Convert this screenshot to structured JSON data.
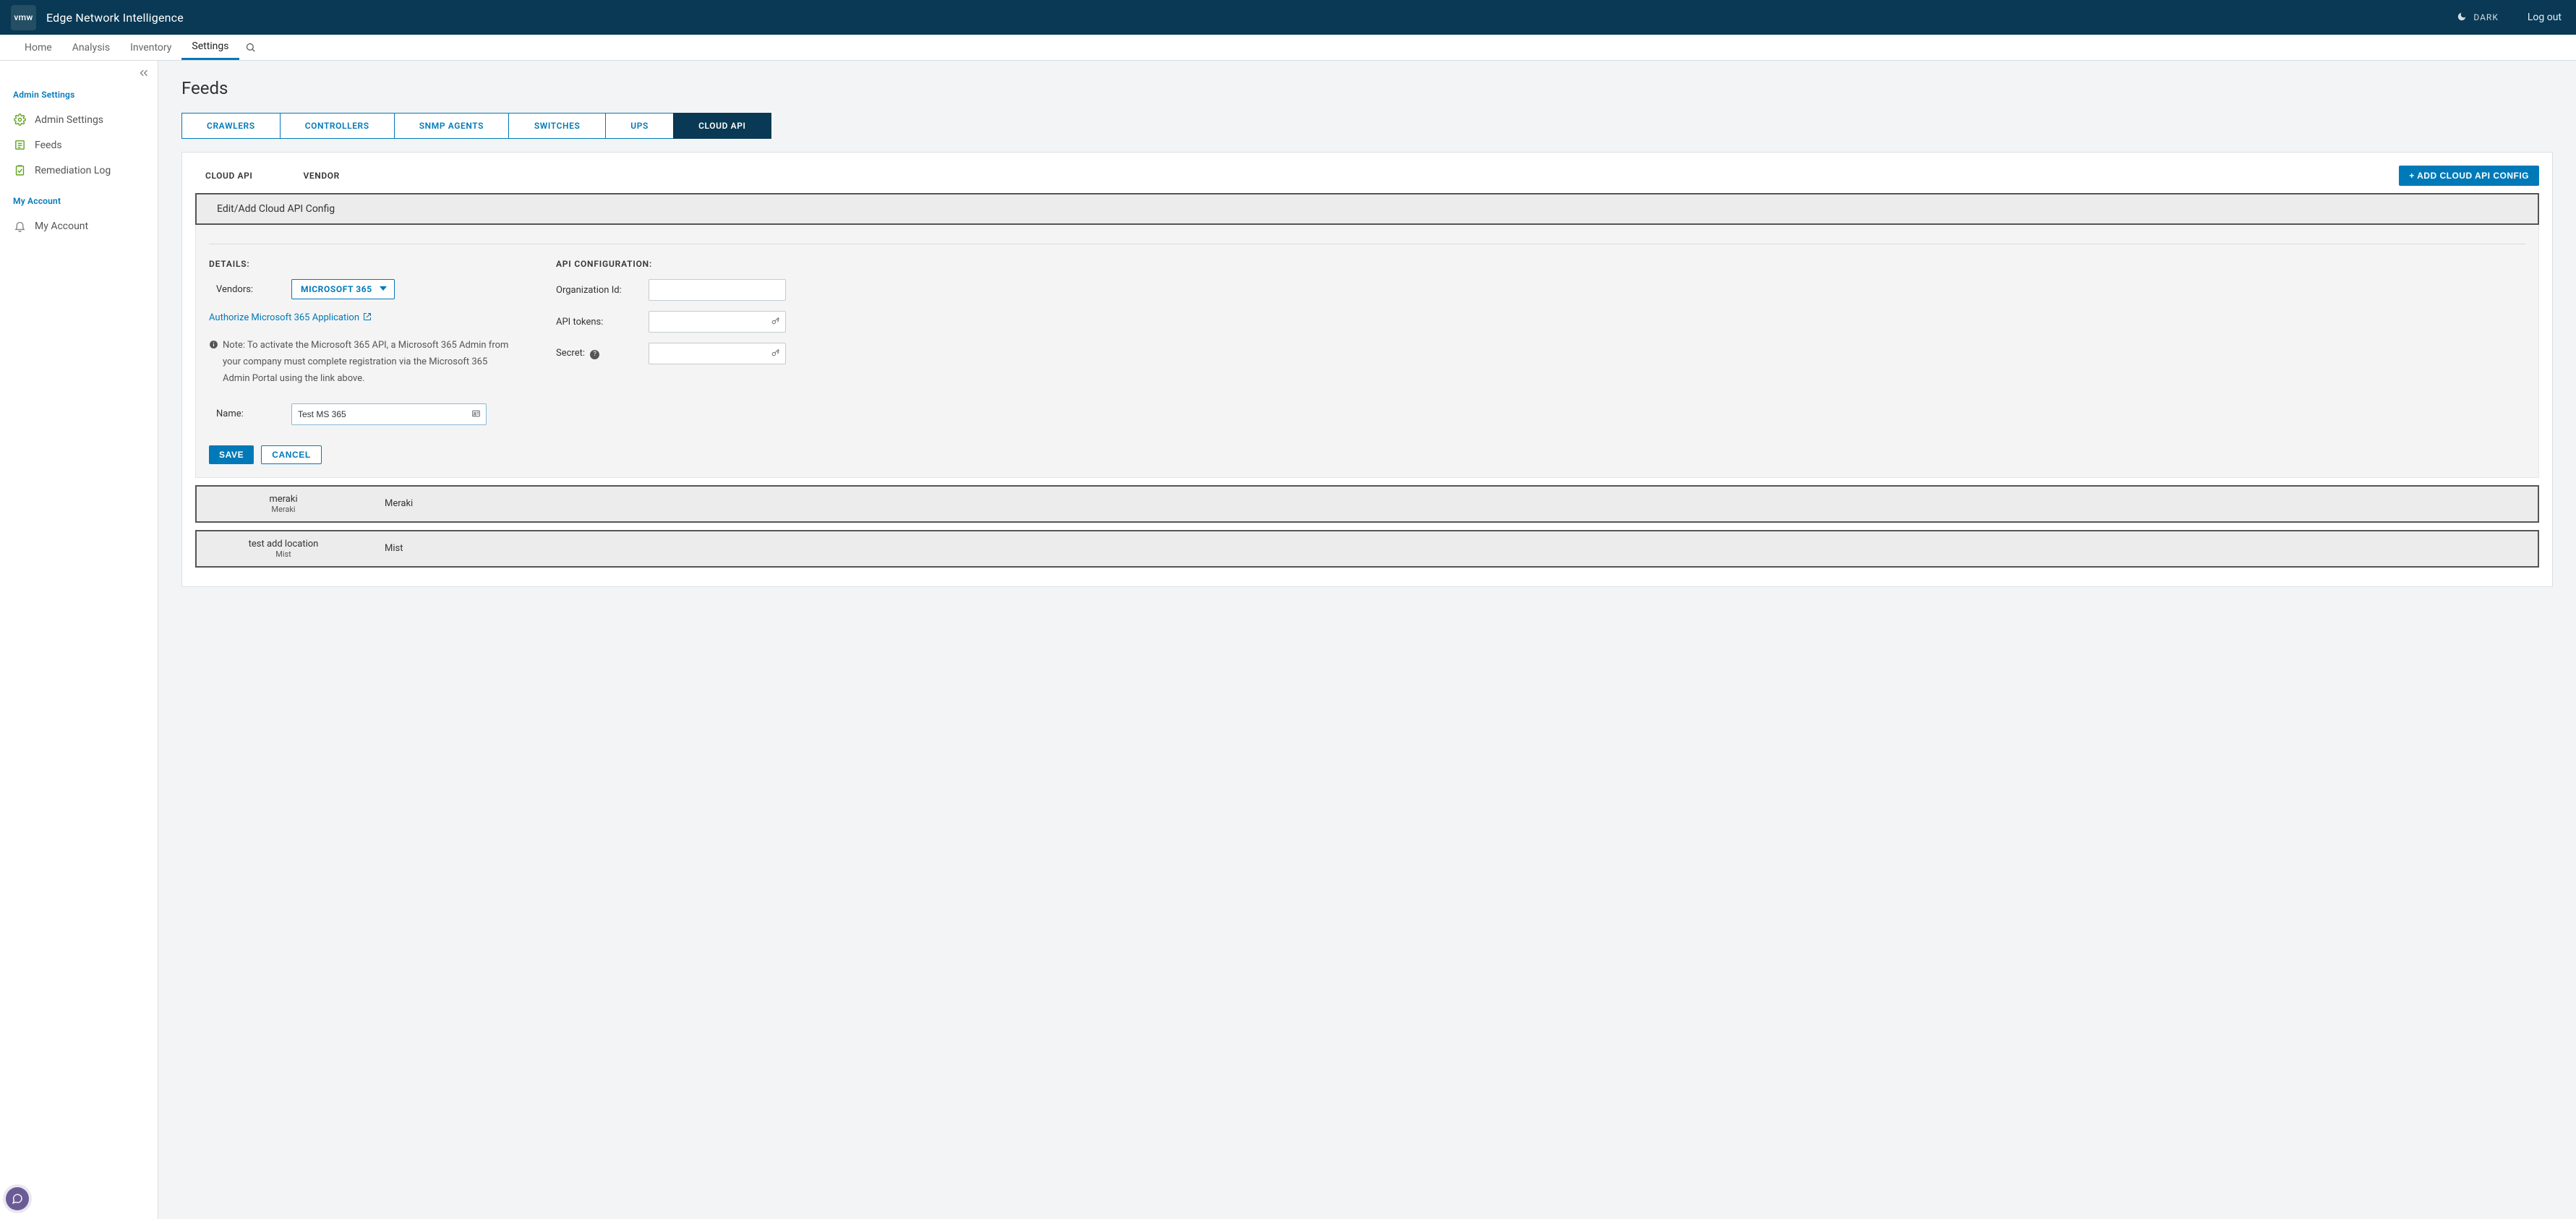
{
  "header": {
    "logo_text": "vmw",
    "title": "Edge Network Intelligence",
    "dark_label": "DARK",
    "logout_label": "Log out"
  },
  "topnav": {
    "items": [
      {
        "label": "Home"
      },
      {
        "label": "Analysis"
      },
      {
        "label": "Inventory"
      },
      {
        "label": "Settings"
      }
    ],
    "active_index": 3
  },
  "sidebar": {
    "section_admin": "Admin Settings",
    "items_admin": [
      {
        "label": "Admin Settings"
      },
      {
        "label": "Feeds"
      },
      {
        "label": "Remediation Log"
      }
    ],
    "section_account": "My Account",
    "items_account": [
      {
        "label": "My Account"
      }
    ]
  },
  "page": {
    "title": "Feeds",
    "tabs": [
      {
        "label": "CRAWLERS"
      },
      {
        "label": "CONTROLLERS"
      },
      {
        "label": "SNMP AGENTS"
      },
      {
        "label": "SWITCHES"
      },
      {
        "label": "UPS"
      },
      {
        "label": "CLOUD API"
      }
    ],
    "active_tab_index": 5,
    "sub_headers": {
      "col1": "CLOUD API",
      "col2": "VENDOR"
    },
    "add_button": "+ ADD CLOUD API CONFIG",
    "config_band_title": "Edit/Add Cloud API Config",
    "details_title": "DETAILS:",
    "vendors_label": "Vendors:",
    "vendor_selected": "MICROSOFT 365",
    "authorize_link": "Authorize Microsoft 365 Application",
    "note_text": "Note: To activate the Microsoft 365 API, a Microsoft 365 Admin from your company must complete registration via the Microsoft 365 Admin Portal using the link above.",
    "name_label": "Name:",
    "name_value": "Test MS 365",
    "api_conf_title": "API CONFIGURATION:",
    "org_label": "Organization Id:",
    "org_value": "",
    "tokens_label": "API tokens:",
    "tokens_value": "",
    "secret_label": "Secret:",
    "secret_value": "",
    "save_label": "SAVE",
    "cancel_label": "CANCEL",
    "listings": [
      {
        "title": "meraki",
        "sub": "Meraki",
        "vendor": "Meraki"
      },
      {
        "title": "test add location",
        "sub": "Mist",
        "vendor": "Mist"
      }
    ]
  }
}
